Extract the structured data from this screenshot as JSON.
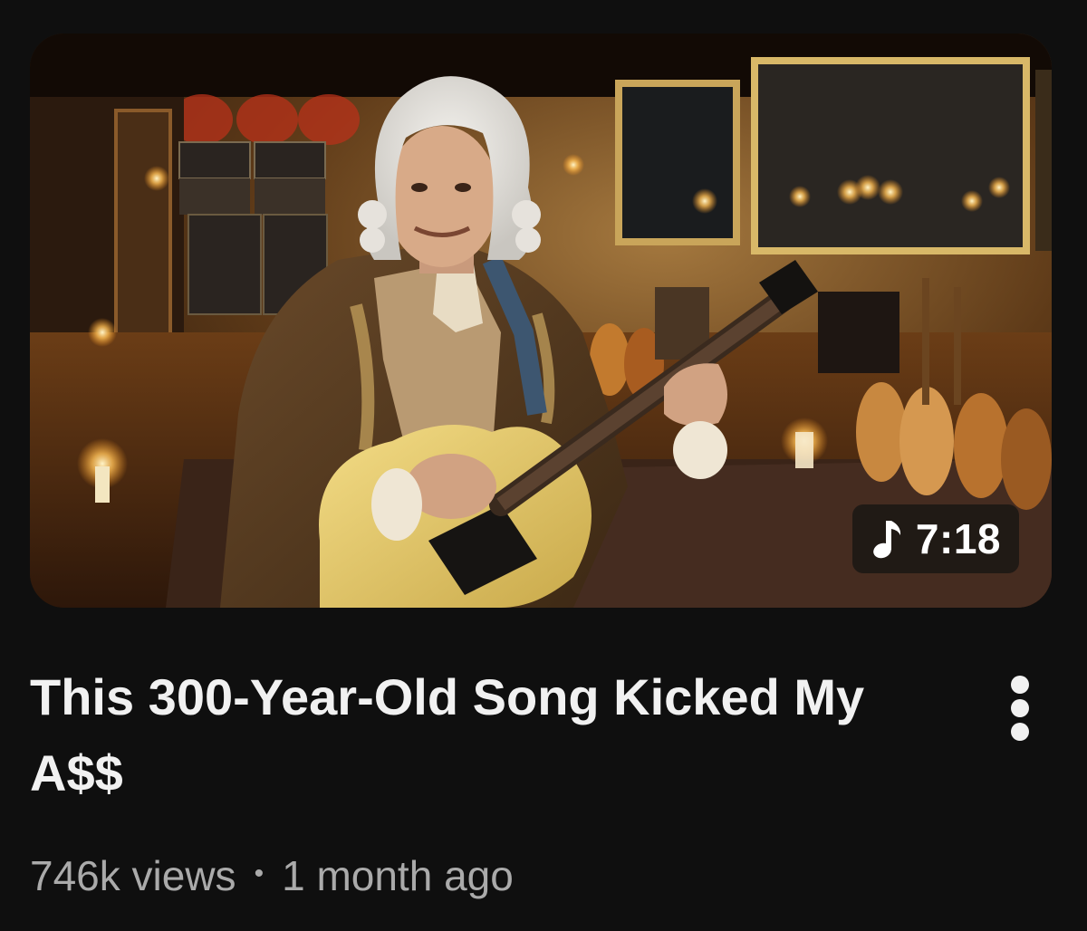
{
  "video": {
    "title": "This 300-Year-Old Song Kicked My A$$",
    "duration": "7:18",
    "duration_icon": "music-note-icon",
    "views": "746k views",
    "separator": "•",
    "published": "1 month ago"
  },
  "menu": {
    "icon": "more-vertical-icon"
  },
  "colors": {
    "background": "#0f0f0f",
    "title_text": "#f1f1f1",
    "meta_text": "#aaaaaa",
    "badge_bg": "#191614"
  }
}
